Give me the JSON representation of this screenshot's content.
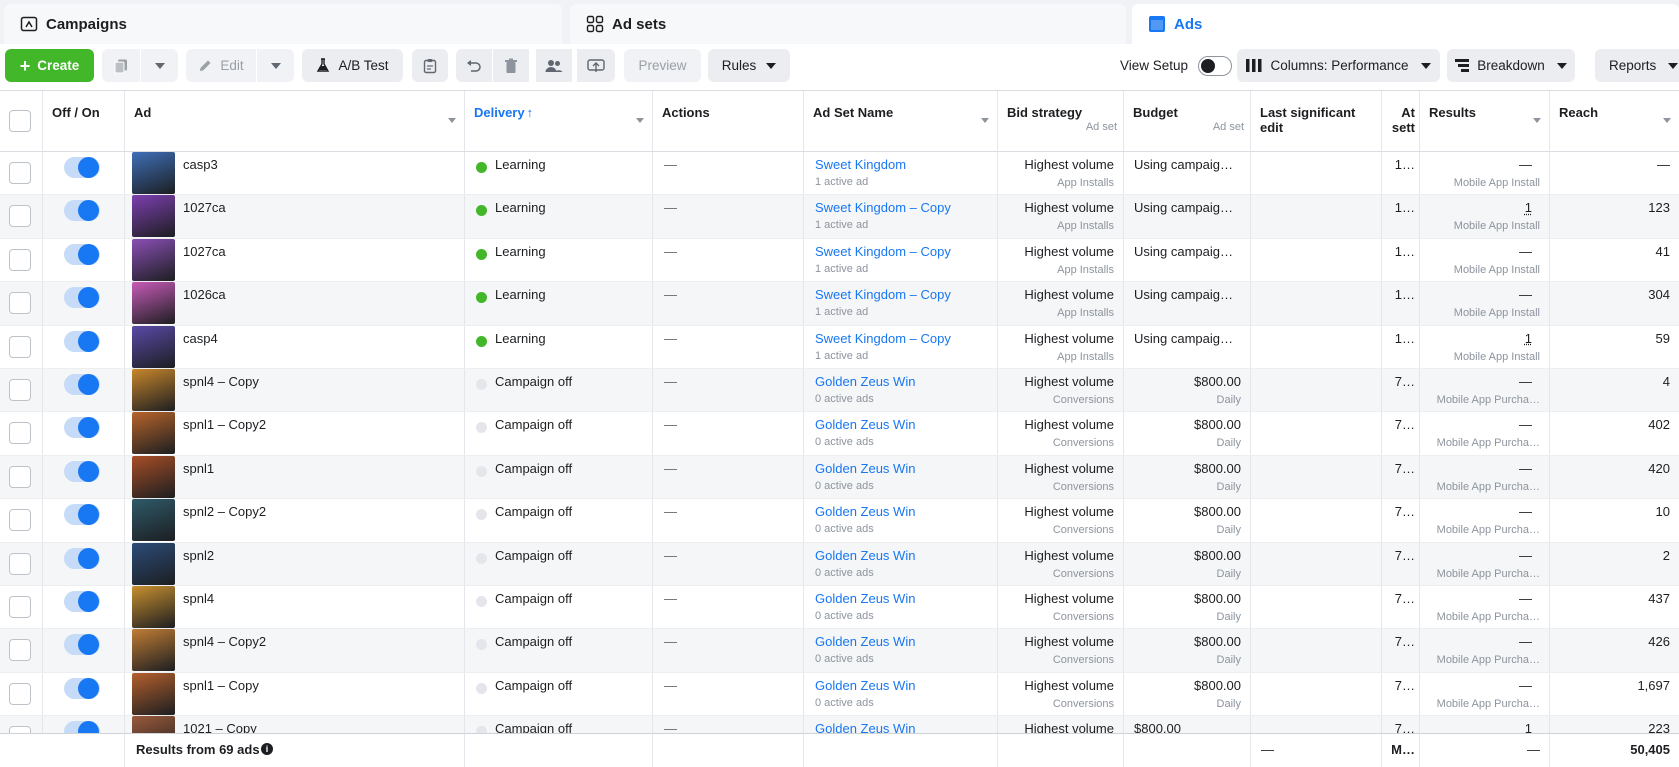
{
  "tabs": {
    "campaigns": "Campaigns",
    "adsets": "Ad sets",
    "ads": "Ads"
  },
  "toolbar": {
    "create": "Create",
    "edit": "Edit",
    "ab_test": "A/B Test",
    "preview": "Preview",
    "rules": "Rules",
    "view_setup": "View Setup",
    "columns": "Columns: Performance",
    "breakdown": "Breakdown",
    "reports": "Reports"
  },
  "columns": {
    "off_on": "Off / On",
    "ad": "Ad",
    "delivery": "Delivery",
    "actions": "Actions",
    "ad_set_name": "Ad Set Name",
    "bid_strategy": "Bid strategy",
    "bid_strategy_sub": "Ad set",
    "budget": "Budget",
    "budget_sub": "Ad set",
    "last_edit_1": "Last significant",
    "last_edit_2": "edit",
    "attr_1": "At",
    "attr_2": "sett",
    "results": "Results",
    "reach": "Reach"
  },
  "rows": [
    {
      "ad": "casp3",
      "thumb": "#3f6fb8",
      "delivery": "Learning",
      "status_color": "#42b72a",
      "actions": "—",
      "adset": "Sweet Kingdom",
      "adset_sub": "1 active ad",
      "bid": "Highest volume",
      "bid_sub": "App Installs",
      "budget": "Using campaig…",
      "budget_sub": "",
      "attr": "1…",
      "result": "—",
      "result_sub": "Mobile App Install",
      "reach": "—"
    },
    {
      "ad": "1027ca",
      "thumb": "#7d3fb0",
      "delivery": "Learning",
      "status_color": "#42b72a",
      "actions": "—",
      "adset": "Sweet Kingdom – Copy",
      "adset_sub": "1 active ad",
      "bid": "Highest volume",
      "bid_sub": "App Installs",
      "budget": "Using campaig…",
      "budget_sub": "",
      "attr": "1…",
      "result": "1",
      "result_sub": "Mobile App Install",
      "reach": "123"
    },
    {
      "ad": "1027ca",
      "thumb": "#8a4fb5",
      "delivery": "Learning",
      "status_color": "#42b72a",
      "actions": "—",
      "adset": "Sweet Kingdom – Copy",
      "adset_sub": "1 active ad",
      "bid": "Highest volume",
      "bid_sub": "App Installs",
      "budget": "Using campaig…",
      "budget_sub": "",
      "attr": "1…",
      "result": "—",
      "result_sub": "Mobile App Install",
      "reach": "41"
    },
    {
      "ad": "1026ca",
      "thumb": "#c85bb8",
      "delivery": "Learning",
      "status_color": "#42b72a",
      "actions": "—",
      "adset": "Sweet Kingdom – Copy",
      "adset_sub": "1 active ad",
      "bid": "Highest volume",
      "bid_sub": "App Installs",
      "budget": "Using campaig…",
      "budget_sub": "",
      "attr": "1…",
      "result": "—",
      "result_sub": "Mobile App Install",
      "reach": "304"
    },
    {
      "ad": "casp4",
      "thumb": "#5a4aa8",
      "delivery": "Learning",
      "status_color": "#42b72a",
      "actions": "—",
      "adset": "Sweet Kingdom – Copy",
      "adset_sub": "1 active ad",
      "bid": "Highest volume",
      "bid_sub": "App Installs",
      "budget": "Using campaig…",
      "budget_sub": "",
      "attr": "1…",
      "result": "1",
      "result_sub": "Mobile App Install",
      "reach": "59"
    },
    {
      "ad": "spnl4 – Copy",
      "thumb": "#c8862b",
      "delivery": "Campaign off",
      "status_color": "#e4e6eb",
      "actions": "—",
      "adset": "Golden Zeus Win",
      "adset_sub": "0 active ads",
      "bid": "Highest volume",
      "bid_sub": "Conversions",
      "budget": "$800.00",
      "budget_sub": "Daily",
      "attr": "7…",
      "result": "—",
      "result_sub": "Mobile App Purcha…",
      "reach": "4"
    },
    {
      "ad": "spnl1 – Copy2",
      "thumb": "#b8642a",
      "delivery": "Campaign off",
      "status_color": "#e4e6eb",
      "actions": "—",
      "adset": "Golden Zeus Win",
      "adset_sub": "0 active ads",
      "bid": "Highest volume",
      "bid_sub": "Conversions",
      "budget": "$800.00",
      "budget_sub": "Daily",
      "attr": "7…",
      "result": "—",
      "result_sub": "Mobile App Purcha…",
      "reach": "402"
    },
    {
      "ad": "spnl1",
      "thumb": "#a84e26",
      "delivery": "Campaign off",
      "status_color": "#e4e6eb",
      "actions": "—",
      "adset": "Golden Zeus Win",
      "adset_sub": "0 active ads",
      "bid": "Highest volume",
      "bid_sub": "Conversions",
      "budget": "$800.00",
      "budget_sub": "Daily",
      "attr": "7…",
      "result": "—",
      "result_sub": "Mobile App Purcha…",
      "reach": "420"
    },
    {
      "ad": "spnl2 – Copy2",
      "thumb": "#2f5a6a",
      "delivery": "Campaign off",
      "status_color": "#e4e6eb",
      "actions": "—",
      "adset": "Golden Zeus Win",
      "adset_sub": "0 active ads",
      "bid": "Highest volume",
      "bid_sub": "Conversions",
      "budget": "$800.00",
      "budget_sub": "Daily",
      "attr": "7…",
      "result": "—",
      "result_sub": "Mobile App Purcha…",
      "reach": "10"
    },
    {
      "ad": "spnl2",
      "thumb": "#2c4c78",
      "delivery": "Campaign off",
      "status_color": "#e4e6eb",
      "actions": "—",
      "adset": "Golden Zeus Win",
      "adset_sub": "0 active ads",
      "bid": "Highest volume",
      "bid_sub": "Conversions",
      "budget": "$800.00",
      "budget_sub": "Daily",
      "attr": "7…",
      "result": "—",
      "result_sub": "Mobile App Purcha…",
      "reach": "2"
    },
    {
      "ad": "spnl4",
      "thumb": "#c9902f",
      "delivery": "Campaign off",
      "status_color": "#e4e6eb",
      "actions": "—",
      "adset": "Golden Zeus Win",
      "adset_sub": "0 active ads",
      "bid": "Highest volume",
      "bid_sub": "Conversions",
      "budget": "$800.00",
      "budget_sub": "Daily",
      "attr": "7…",
      "result": "—",
      "result_sub": "Mobile App Purcha…",
      "reach": "437"
    },
    {
      "ad": "spnl4 – Copy2",
      "thumb": "#c17d34",
      "delivery": "Campaign off",
      "status_color": "#e4e6eb",
      "actions": "—",
      "adset": "Golden Zeus Win",
      "adset_sub": "0 active ads",
      "bid": "Highest volume",
      "bid_sub": "Conversions",
      "budget": "$800.00",
      "budget_sub": "Daily",
      "attr": "7…",
      "result": "—",
      "result_sub": "Mobile App Purcha…",
      "reach": "426"
    },
    {
      "ad": "spnl1 – Copy",
      "thumb": "#b5602c",
      "delivery": "Campaign off",
      "status_color": "#e4e6eb",
      "actions": "—",
      "adset": "Golden Zeus Win",
      "adset_sub": "0 active ads",
      "bid": "Highest volume",
      "bid_sub": "Conversions",
      "budget": "$800.00",
      "budget_sub": "Daily",
      "attr": "7…",
      "result": "—",
      "result_sub": "Mobile App Purcha…",
      "reach": "1,697"
    },
    {
      "ad": "1021 – Copy",
      "thumb": "#9b5a3a",
      "delivery": "Campaign off",
      "status_color": "#e4e6eb",
      "actions": "—",
      "adset": "Golden Zeus Win",
      "adset_sub": "",
      "bid": "Highest volume",
      "bid_sub": "",
      "budget": "$800.00",
      "budget_sub": "",
      "attr": "7…",
      "result": "1",
      "result_sub": "",
      "reach": "223"
    }
  ],
  "footer": {
    "results_label": "Results from 69 ads",
    "last_edit": "—",
    "attr": "M…",
    "results": "—",
    "reach": "50,405"
  },
  "icons": [
    "campaigns-icon",
    "adsets-icon",
    "ads-icon",
    "plus-icon",
    "duplicate-icon",
    "pencil-icon",
    "flask-icon",
    "clipboard-icon",
    "undo-icon",
    "trash-icon",
    "people-icon",
    "export-icon",
    "columns-icon",
    "breakdown-icon",
    "info-icon"
  ]
}
